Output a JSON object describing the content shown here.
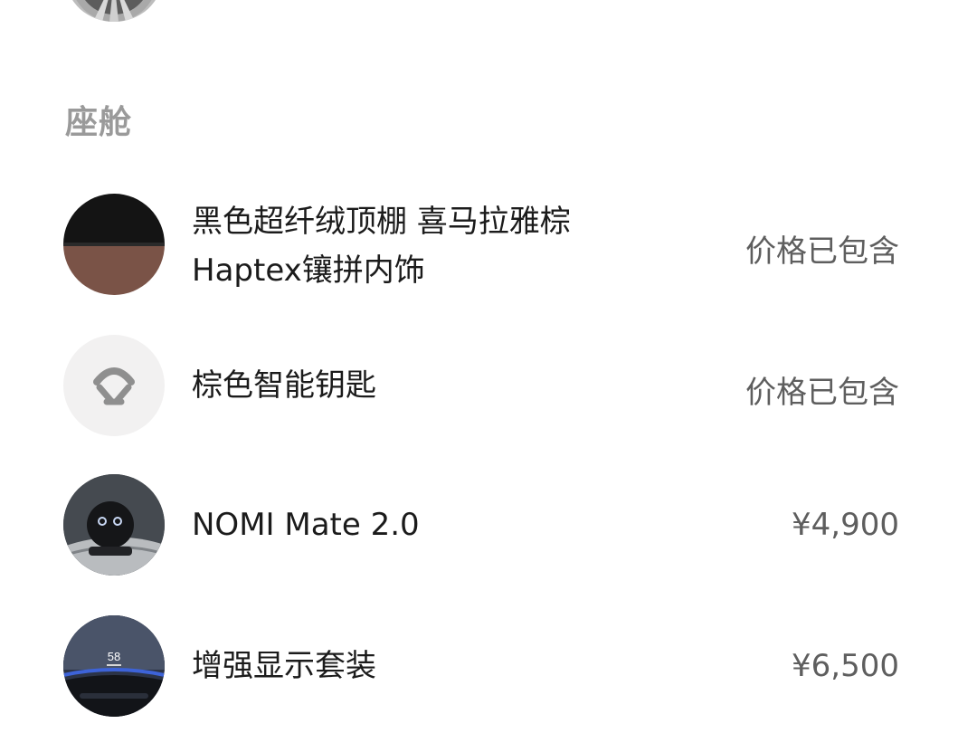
{
  "section": {
    "title": "座舱"
  },
  "items": [
    {
      "name_line1": "黑色超纤绒顶棚 喜马拉雅棕",
      "name_line2": "Haptex镶拼内饰",
      "price": "价格已包含",
      "thumb_icon": "trim-swatch-thumbnail"
    },
    {
      "name": "棕色智能钥匙",
      "price": "价格已包含",
      "thumb_icon": "nio-logo-icon"
    },
    {
      "name": "NOMI Mate 2.0",
      "price": "¥4,900",
      "thumb_icon": "nomi-robot-thumbnail"
    },
    {
      "name": "增强显示套装",
      "price": "¥6,500",
      "thumb_icon": "hud-display-thumbnail",
      "thumb_readout": "58"
    }
  ],
  "colors": {
    "background": "#ffffff",
    "section_title": "#9a9a9a",
    "item_text": "#1b1b1b",
    "price_text": "#5e5e5e",
    "swatch_top": "#141414",
    "swatch_bottom": "#7a5347"
  }
}
